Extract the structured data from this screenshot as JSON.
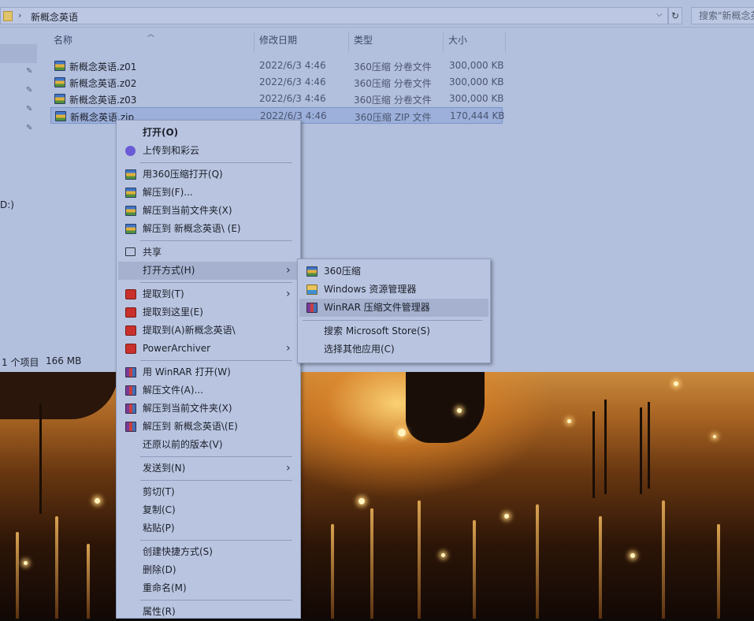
{
  "address": {
    "path": "新概念英语",
    "search_placeholder": "搜索\"新概念英"
  },
  "columns": {
    "name": "名称",
    "date": "修改日期",
    "type": "类型",
    "size": "大小"
  },
  "files": [
    {
      "name": "新概念英语.z01",
      "date": "2022/6/3 4:46",
      "type": "360压缩 分卷文件",
      "size": "300,000 KB"
    },
    {
      "name": "新概念英语.z02",
      "date": "2022/6/3 4:46",
      "type": "360压缩 分卷文件",
      "size": "300,000 KB"
    },
    {
      "name": "新概念英语.z03",
      "date": "2022/6/3 4:46",
      "type": "360压缩 分卷文件",
      "size": "300,000 KB"
    },
    {
      "name": "新概念英语.zip",
      "date": "2022/6/3 4:46",
      "type": "360压缩 ZIP 文件",
      "size": "170,444 KB"
    }
  ],
  "nav": {
    "drive_label": "D:)"
  },
  "status": {
    "selected": "1 个项目",
    "size": "166 MB"
  },
  "context_menu": {
    "open": "打开(O)",
    "upload": "上传到和彩云",
    "open_360": "用360压缩打开(Q)",
    "extract_to": "解压到(F)...",
    "extract_here": "解压到当前文件夹(X)",
    "extract_folder": "解压到 新概念英语\\ (E)",
    "share": "共享",
    "open_with": "打开方式(H)",
    "pa_extract_to": "提取到(T)",
    "pa_extract_here": "提取到这里(E)",
    "pa_extract_folder": "提取到(A)新概念英语\\",
    "power_archiver": "PowerArchiver",
    "winrar_open": "用 WinRAR 打开(W)",
    "winrar_extract": "解压文件(A)...",
    "winrar_extract_here": "解压到当前文件夹(X)",
    "winrar_extract_folder": "解压到 新概念英语\\(E)",
    "restore": "还原以前的版本(V)",
    "send_to": "发送到(N)",
    "cut": "剪切(T)",
    "copy": "复制(C)",
    "paste": "粘贴(P)",
    "shortcut": "创建快捷方式(S)",
    "delete": "删除(D)",
    "rename": "重命名(M)",
    "properties": "属性(R)"
  },
  "submenu": {
    "app_360": "360压缩",
    "app_explorer": "Windows 资源管理器",
    "app_winrar": "WinRAR 压缩文件管理器",
    "search_store": "搜索 Microsoft Store(S)",
    "choose_other": "选择其他应用(C)"
  }
}
